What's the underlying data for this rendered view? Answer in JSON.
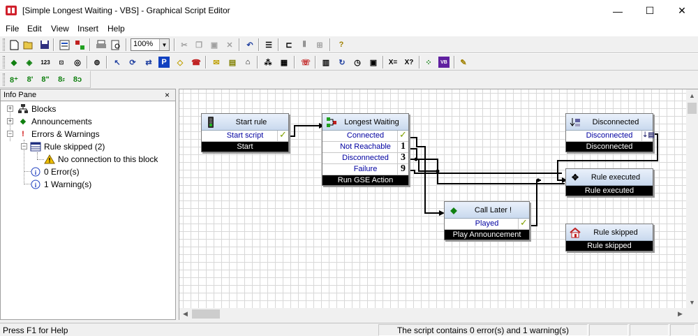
{
  "window": {
    "title": "[Simple Longest Waiting - VBS] - Graphical Script Editor",
    "minimize": "—",
    "maximize": "☐",
    "close": "✕"
  },
  "menu": [
    "File",
    "Edit",
    "View",
    "Insert",
    "Help"
  ],
  "toolbar": {
    "zoom": "100%"
  },
  "info_pane": {
    "title": "Info Pane",
    "close": "×",
    "tree": {
      "blocks": "Blocks",
      "announcements": "Announcements",
      "errors_warnings": "Errors & Warnings",
      "rule_skipped": "Rule skipped  (2)",
      "no_connection": "No connection to this block",
      "errors": "0 Error(s)",
      "warnings": "1 Warning(s)"
    }
  },
  "blocks": {
    "start_rule": {
      "title": "Start rule",
      "rows": [
        "Start script"
      ],
      "footer": "Start"
    },
    "longest_waiting": {
      "title": "Longest Waiting",
      "rows": [
        "Connected",
        "Not Reachable",
        "Disconnected",
        "Failure"
      ],
      "marks": [
        "1",
        "3",
        "9"
      ],
      "footer": "Run GSE Action"
    },
    "call_later": {
      "title": "Call Later !",
      "rows": [
        "Played"
      ],
      "footer": "Play Announcement"
    },
    "disconnected": {
      "title": "Disconnected",
      "rows": [
        "Disconnected"
      ],
      "footer": "Disconnected"
    },
    "rule_executed": {
      "title": "Rule executed",
      "footer": "Rule executed"
    },
    "rule_skipped": {
      "title": "Rule skipped",
      "footer": "Rule skipped"
    }
  },
  "status": {
    "help": "Press F1 for Help",
    "message": "The script contains 0 error(s) and 1 warning(s)"
  },
  "colors": {
    "block_header": "#c9d9ee",
    "row_text": "#0000a0",
    "check": "#80a000",
    "warning": "#f0c000"
  }
}
